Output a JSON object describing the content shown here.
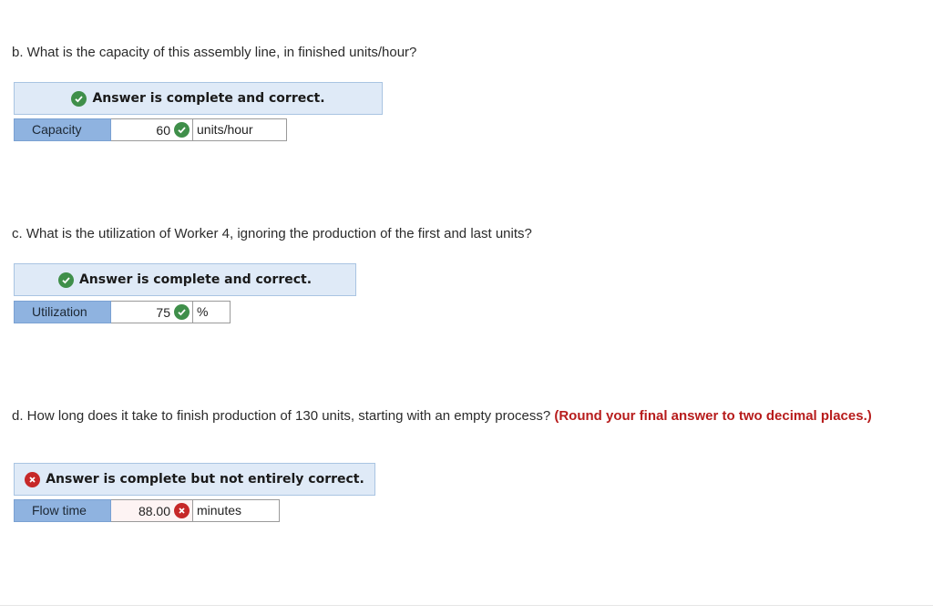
{
  "parts": [
    {
      "question": "b. What is the capacity of this assembly line, in finished units/hour?",
      "question_emphasis": "",
      "status": "correct",
      "banner": "Answer is complete and correct.",
      "label": "Capacity",
      "value": "60",
      "unit": "units/hour"
    },
    {
      "question": "c. What is the utilization of Worker 4, ignoring the production of the first and last units?",
      "question_emphasis": "",
      "status": "correct",
      "banner": "Answer is complete and correct.",
      "label": "Utilization",
      "value": "75",
      "unit": "%"
    },
    {
      "question": "d. How long does it take to finish production of 130 units, starting with an empty process?",
      "question_emphasis": "(Round your final answer to two decimal places.)",
      "status": "incorrect",
      "banner": "Answer is complete but not entirely correct.",
      "label": "Flow time",
      "value": "88.00",
      "unit": "minutes"
    }
  ],
  "colors": {
    "correct": "#3f8f4a",
    "incorrect": "#c62828",
    "banner_bg": "#dfeaf7",
    "label_bg": "#8fb3e0",
    "emphasis": "#b71c1c"
  },
  "icons": {
    "correct": "check-circle-icon",
    "incorrect": "x-circle-icon"
  }
}
